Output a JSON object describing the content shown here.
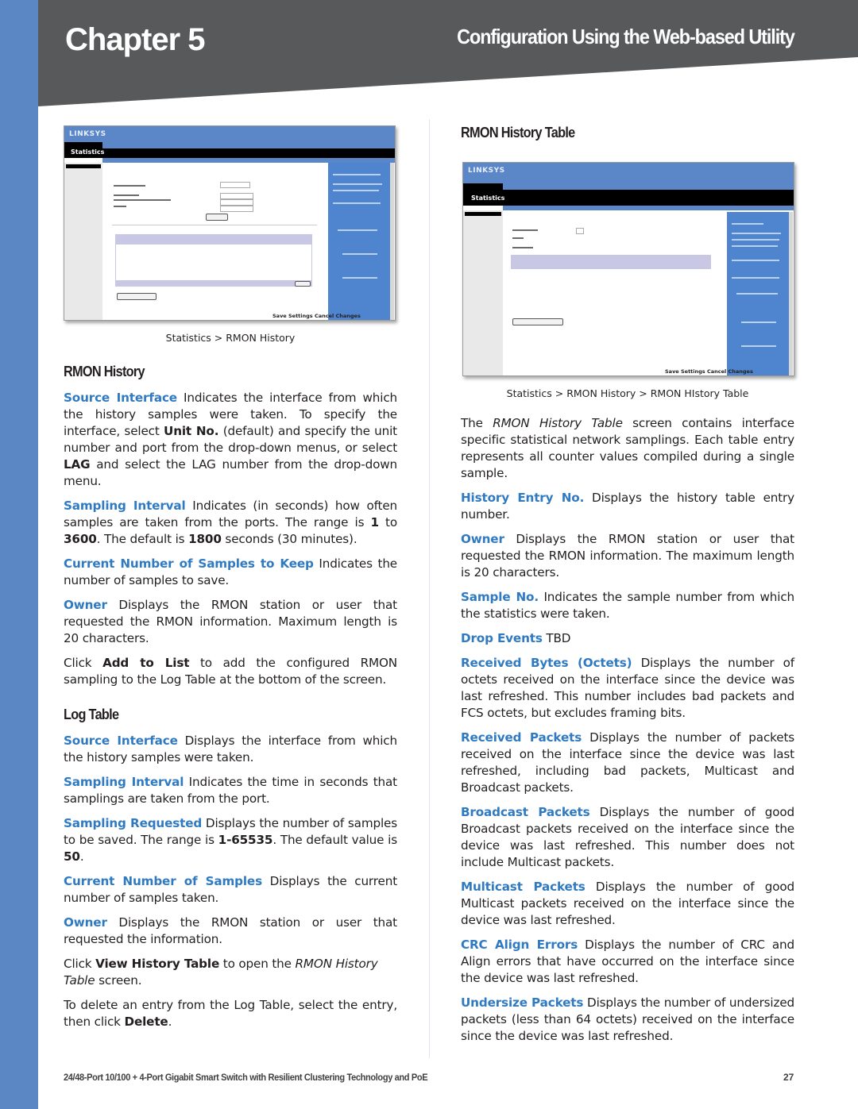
{
  "header": {
    "chapter": "Chapter 5",
    "section_title": "Configuration Using the Web-based Utility",
    "colors": {
      "band": "#58595b",
      "strip": "#5b87c5",
      "term": "#2f7ac1"
    }
  },
  "left_column": {
    "screenshot": {
      "logo": "LINKSYS",
      "nav_label": "Statistics",
      "save_label": "Save Settings",
      "cancel_label": "Cancel Changes",
      "caption": "Statistics > RMON History"
    },
    "rmon_history": {
      "heading": "RMON History",
      "source_interface": {
        "term": "Source Interface",
        "text1": " Indicates the interface from which the history samples were taken. To specify the interface, select ",
        "bold1": "Unit No.",
        "text2": " (default) and specify the unit number and port from the drop-down menus, or select ",
        "bold2": "LAG",
        "text3": " and select the LAG number from the drop-down menu."
      },
      "sampling_interval": {
        "term": "Sampling Interval",
        "text1": " Indicates (in seconds) how often samples are taken from the ports. The range is ",
        "bold1": "1",
        "text2": " to ",
        "bold2": "3600",
        "text3": ". The default is ",
        "bold3": "1800",
        "text4": " seconds (30 minutes)."
      },
      "samples_to_keep": {
        "term": "Current Number of Samples to Keep",
        "text": " Indicates the number of samples to save."
      },
      "owner": {
        "term": "Owner",
        "text": " Displays the RMON station or user that requested the RMON information. Maximum length is 20 characters."
      },
      "add_to_list": {
        "text1": "Click ",
        "bold": "Add to List",
        "text2": " to add the configured RMON sampling to the Log Table at the bottom of the screen."
      }
    },
    "log_table": {
      "heading": "Log Table",
      "source_interface": {
        "term": "Source Interface",
        "text": " Displays the interface from which the history samples were taken."
      },
      "sampling_interval": {
        "term": "Sampling Interval",
        "text": " Indicates the time in seconds that samplings are taken from the port."
      },
      "sampling_requested": {
        "term": "Sampling Requested",
        "text1": " Displays the number of samples to be saved. The range is ",
        "bold1": "1-65535",
        "text2": ". The default value is ",
        "bold2": "50",
        "text3": "."
      },
      "current_samples": {
        "term": "Current Number of Samples",
        "text": " Displays the current number of samples taken."
      },
      "owner": {
        "term": "Owner",
        "text": " Displays the RMON station or user that requested the information."
      },
      "view_history": {
        "text1": "Click ",
        "bold": "View History Table",
        "text2": " to open the ",
        "italic": "RMON History Table",
        "text3": " screen."
      },
      "delete": {
        "text1": "To delete an entry from the Log Table, select the entry, then click ",
        "bold": "Delete",
        "text2": "."
      }
    }
  },
  "right_column": {
    "heading": "RMON History Table",
    "screenshot": {
      "logo": "LINKSYS",
      "nav_label": "Statistics",
      "save_label": "Save Settings",
      "cancel_label": "Cancel Changes",
      "caption": "Statistics > RMON History > RMON HIstory Table"
    },
    "intro": {
      "text1": "The ",
      "italic": "RMON History Table",
      "text2": " screen contains interface specific statistical network samplings. Each table entry represents all counter values compiled during a single sample."
    },
    "items": [
      {
        "term": "History Entry No.",
        "text": " Displays the history table entry number."
      },
      {
        "term": "Owner",
        "text": " Displays the RMON station or user that requested the RMON information. The maximum length is 20 characters."
      },
      {
        "term": "Sample No.",
        "text": " Indicates the sample number from which the statistics were taken."
      },
      {
        "term": "Drop Events",
        "text": " TBD"
      },
      {
        "term": "Received Bytes (Octets)",
        "text": " Displays the number of octets received on the interface since the device was last refreshed. This number includes bad packets and FCS octets, but excludes framing bits."
      },
      {
        "term": "Received Packets",
        "text": " Displays the number of packets received on the interface since the device was last refreshed, including bad packets, Multicast and Broadcast packets."
      },
      {
        "term": "Broadcast Packets",
        "text": " Displays the number of good Broadcast packets received on the interface since the device was last refreshed. This number does not include Multicast packets."
      },
      {
        "term": "Multicast Packets",
        "text": " Displays the number of good Multicast packets received on the interface since the device was last refreshed."
      },
      {
        "term": "CRC Align Errors",
        "text": " Displays the number of CRC and Align errors that have occurred on the interface since the device was last refreshed."
      },
      {
        "term": "Undersize Packets",
        "text": " Displays the number of undersized packets (less than 64 octets) received on the interface since the device was last refreshed."
      }
    ]
  },
  "footer": {
    "product": "24/48-Port 10/100 + 4-Port Gigabit Smart Switch with Resilient Clustering Technology and PoE",
    "page_number": "27"
  }
}
